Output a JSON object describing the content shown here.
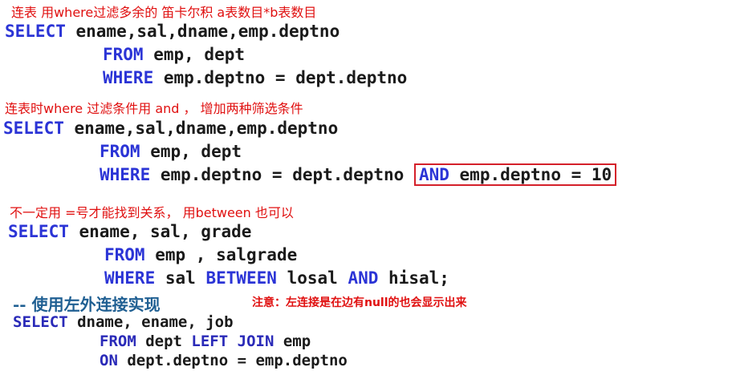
{
  "section1": {
    "note": "连表 用where过滤多余的 笛卡尔积 a表数目*b表数目",
    "select_kw": "SELECT",
    "select_cols": " ename,sal,dname,emp.deptno",
    "from_kw": "FROM",
    "from_tables": " emp, dept",
    "where_kw": "WHERE",
    "where_cond": " emp.deptno = dept.deptno"
  },
  "section2": {
    "note": "连表时where 过滤条件用 and ， 增加两种筛选条件",
    "select_kw": "SELECT",
    "select_cols": " ename,sal,dname,emp.deptno",
    "from_kw": "FROM",
    "from_tables": " emp, dept",
    "where_kw": "WHERE",
    "where_cond": " emp.deptno = dept.deptno ",
    "and_kw": "AND",
    "and_cond": " emp.deptno = 10"
  },
  "section3": {
    "note": "不一定用 =号才能找到关系， 用between 也可以",
    "select_kw": "SELECT",
    "select_cols": " ename, sal, grade",
    "from_kw": "FROM",
    "from_tables": " emp , salgrade",
    "where_kw": "WHERE",
    "where_a": " sal ",
    "between_kw": "BETWEEN",
    "where_b": " losal ",
    "and_kw": "AND",
    "where_c": " hisal;"
  },
  "section4": {
    "comment": "-- 使用左外连接实现",
    "note": "注意：左连接是在边有null的也会显示出来",
    "select_kw": "SELECT",
    "select_cols": " dname, ename, job",
    "from_kw": "FROM",
    "from_a": " dept ",
    "left_kw": "LEFT",
    "join_kw": "JOIN",
    "from_b": " emp",
    "on_kw": "ON",
    "on_cond": " dept.deptno = emp.deptno"
  },
  "colors": {
    "note_red": "#e01010",
    "keyword_blue": "#2b34d6",
    "comment_blue": "#1f5f92",
    "highlight_border": "#d4202a"
  }
}
